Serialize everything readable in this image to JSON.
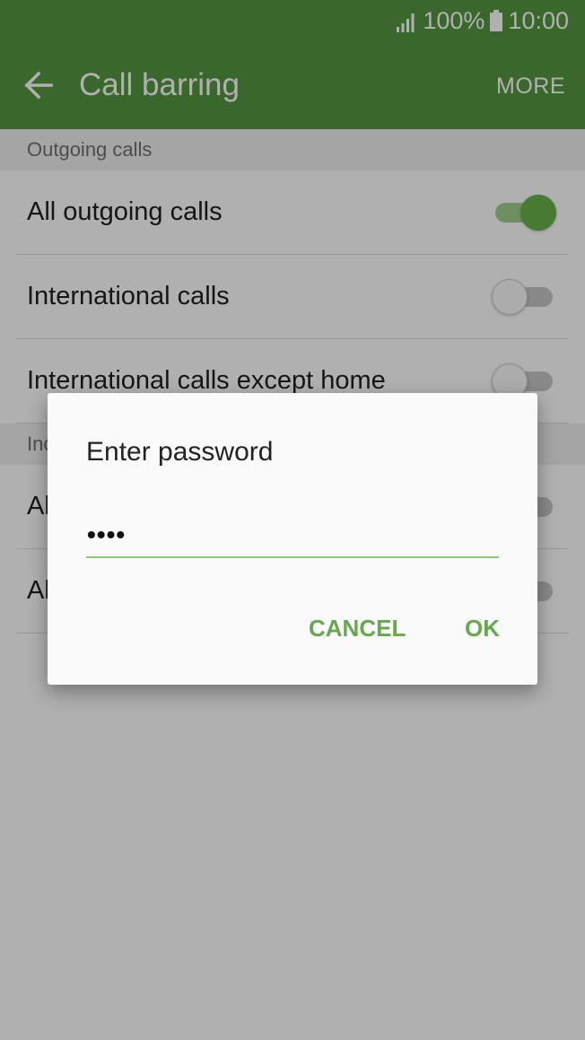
{
  "status_bar": {
    "battery": "100%",
    "time": "10:00",
    "signal_icon": "signal-icon",
    "battery_icon": "battery-icon"
  },
  "action_bar": {
    "title": "Call barring",
    "more_label": "MORE",
    "back_icon": "back-arrow-icon"
  },
  "sections": [
    {
      "header": "Outgoing calls",
      "items": [
        {
          "label": "All outgoing calls",
          "enabled": true
        },
        {
          "label": "International calls",
          "enabled": false
        },
        {
          "label": "International calls except home",
          "enabled": false
        }
      ]
    },
    {
      "header": "Inc",
      "items": [
        {
          "label": "Al",
          "enabled": false
        },
        {
          "label": "Al",
          "enabled": false
        }
      ]
    }
  ],
  "dialog": {
    "title": "Enter password",
    "password_display": "••••",
    "cancel_label": "CANCEL",
    "ok_label": "OK"
  },
  "colors": {
    "accent": "#54963f",
    "button_text": "#66a84e",
    "switch_on": "#66b348"
  }
}
